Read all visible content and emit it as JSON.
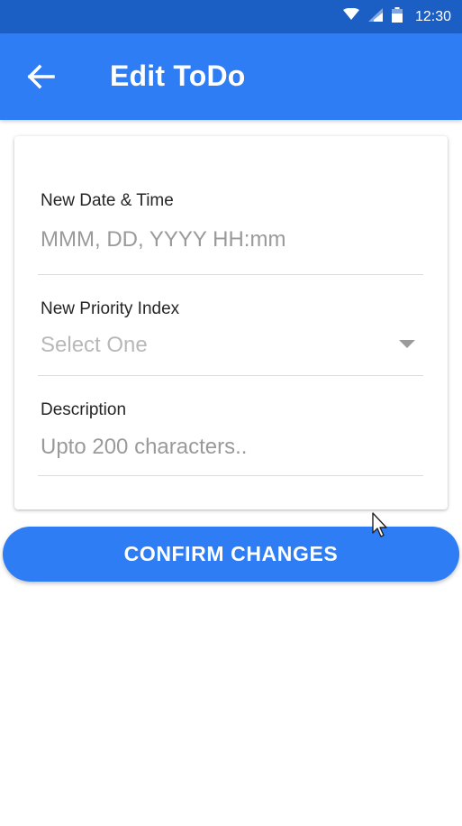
{
  "status_bar": {
    "time": "12:30",
    "icons": [
      "wifi-icon",
      "cell-signal-icon",
      "battery-icon"
    ]
  },
  "app_bar": {
    "back_icon": "arrow-left-icon",
    "title": "Edit ToDo"
  },
  "form": {
    "date_time": {
      "label": "New Date & Time",
      "placeholder": "MMM, DD, YYYY HH:mm"
    },
    "priority": {
      "label": "New Priority Index",
      "selected": "Select One",
      "dropdown_icon": "caret-down-icon"
    },
    "description": {
      "label": "Description",
      "placeholder": "Upto 200 characters.."
    }
  },
  "confirm_button": {
    "label": "CONFIRM CHANGES"
  },
  "colors": {
    "primary": "#2f7df4",
    "status_bar": "#1c5fc4",
    "label_text": "#262626",
    "placeholder_text": "#9a9a9a",
    "divider": "#dcdcdc"
  }
}
